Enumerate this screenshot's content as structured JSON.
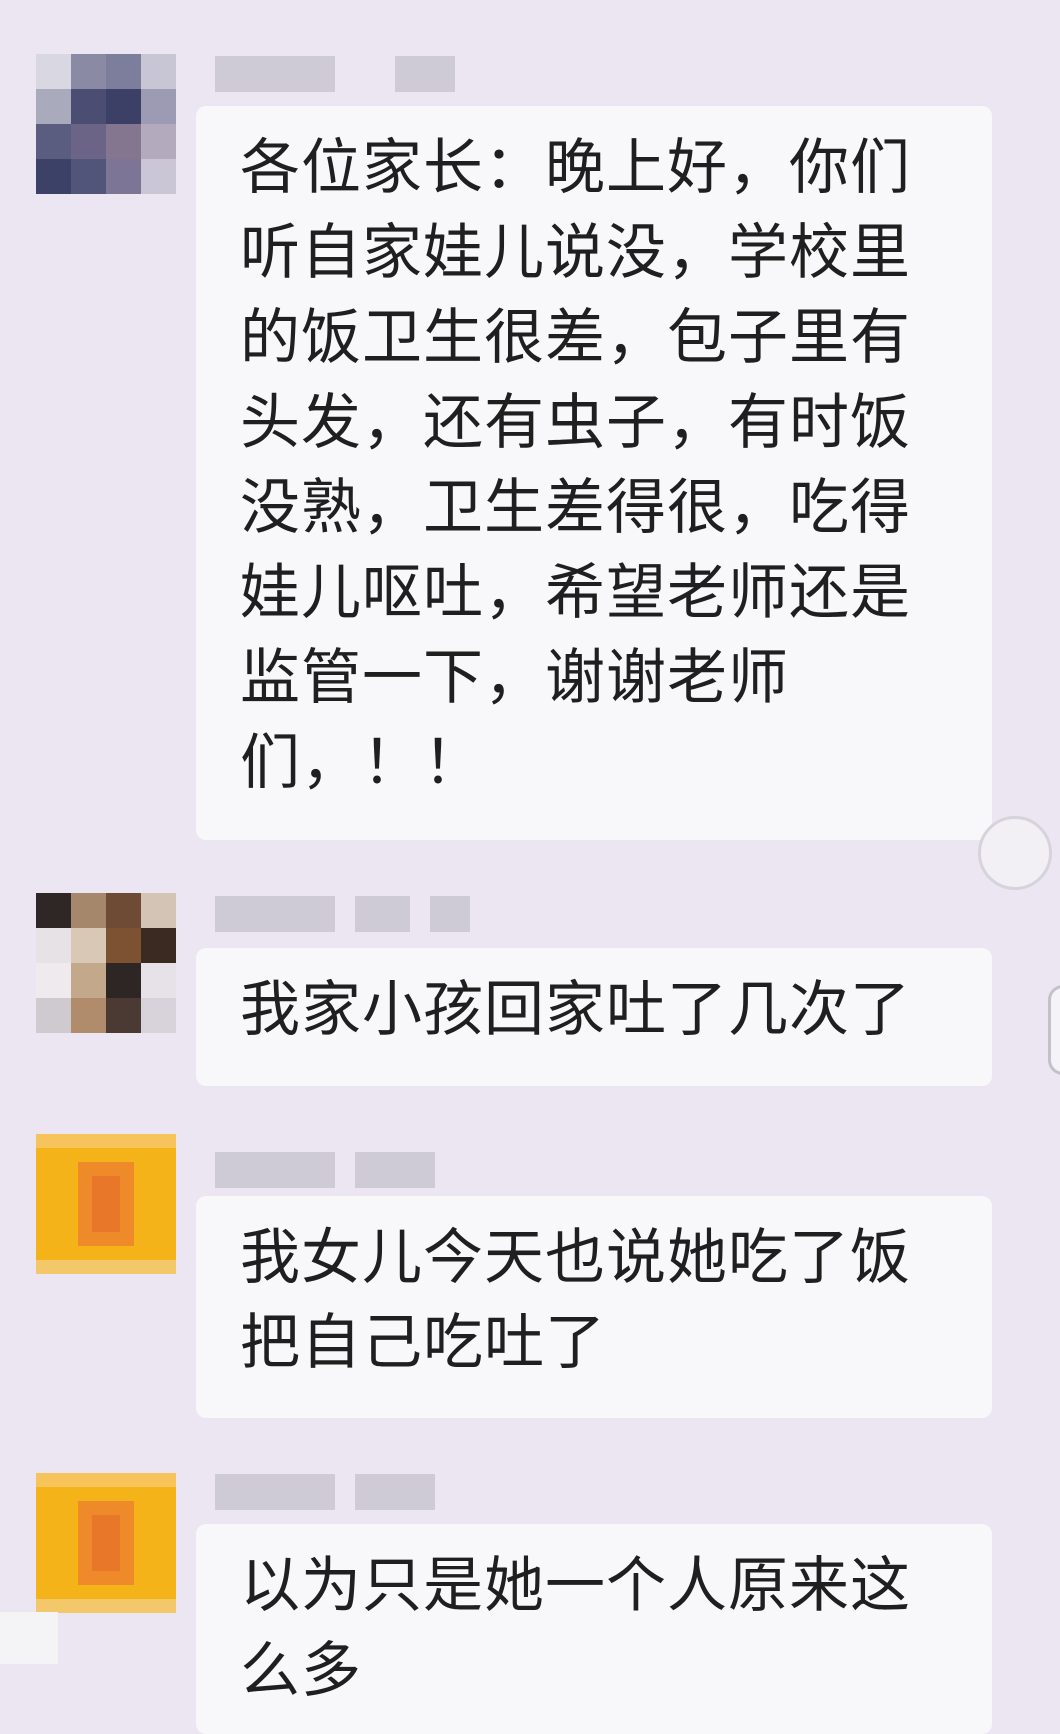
{
  "messages": [
    {
      "avatar_style": "blurred-photo",
      "text": "各位家长：晚上好，你们听自家娃儿说没，学校里的饭卫生很差，包子里有头发，还有虫子，有时饭没熟，卫生差得很，吃得娃儿呕吐，希望老师还是监管一下，谢谢老师们，！！"
    },
    {
      "avatar_style": "blurred-photo",
      "text": "我家小孩回家吐了几次了"
    },
    {
      "avatar_style": "yellow-blurred",
      "text": "我女儿今天也说她吃了饭把自己吃吐了"
    },
    {
      "avatar_style": "yellow-blurred",
      "text": "以为只是她一个人原来这么多"
    }
  ],
  "colors": {
    "background": "#ebe6f2",
    "bubble": "#f8f7fa",
    "text": "#1f1f1f",
    "avatar_yellow": "#f4b419",
    "avatar_orange": "#ef8a2a"
  }
}
